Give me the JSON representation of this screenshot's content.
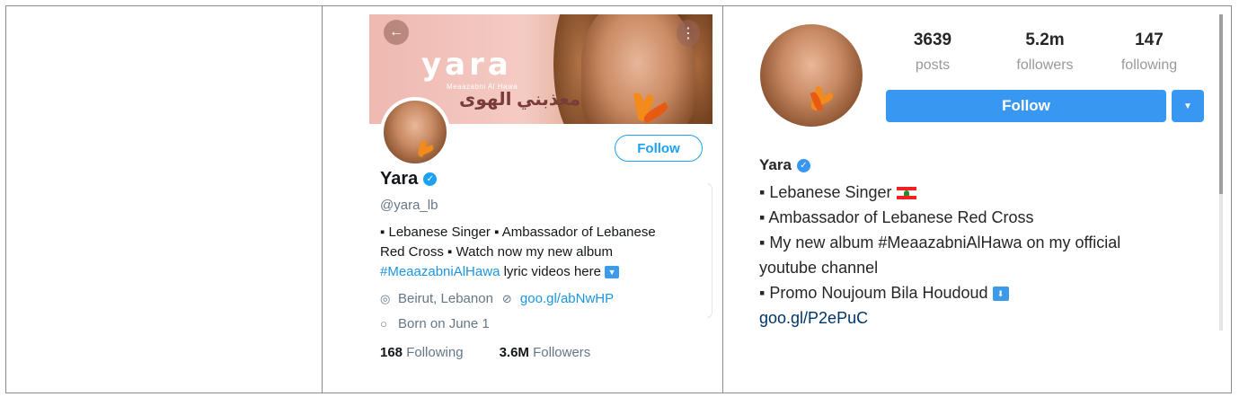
{
  "twitter": {
    "back_glyph": "←",
    "more_glyph": "⋮",
    "banner": {
      "logo_text": "yara",
      "logo_subtitle": "Meaazabni Al Hawa",
      "arabic_title": "معذبني الهوى"
    },
    "follow_label": "Follow",
    "name": "Yara",
    "handle": "@yara_lb",
    "bio": {
      "line1": "▪ Lebanese Singer ▪ Ambassador of Lebanese",
      "line2": "Red Cross ▪ Watch now my new album",
      "hashtag": "#MeaazabniAlHawa",
      "line3_rest": " lyric videos here "
    },
    "location": "Beirut, Lebanon",
    "website": "goo.gl/abNwHP",
    "birthday": "Born on June 1",
    "following_count": "168",
    "following_label": "Following",
    "followers_count": "3.6M",
    "followers_label": "Followers",
    "icons": {
      "location": "location-pin-icon",
      "link": "link-icon",
      "birthday": "balloon-icon",
      "download": "down-arrow-emoji-icon"
    }
  },
  "instagram": {
    "posts_count": "3639",
    "posts_label": "posts",
    "followers_count": "5.2m",
    "followers_label": "followers",
    "following_count": "147",
    "following_label": "following",
    "follow_label": "Follow",
    "dropdown_glyph": "▼",
    "name": "Yara",
    "bio": [
      "▪ Lebanese Singer ",
      "▪ Ambassador of Lebanese Red Cross",
      "▪ My new album #MeaazabniAlHawa on my official",
      "youtube channel",
      "▪ Promo Noujoum Bila Houdoud "
    ],
    "link": "goo.gl/P2ePuC"
  },
  "colors": {
    "twitter_blue": "#1da1f2",
    "instagram_blue": "#3897f0",
    "border": "#8c8c8c"
  }
}
